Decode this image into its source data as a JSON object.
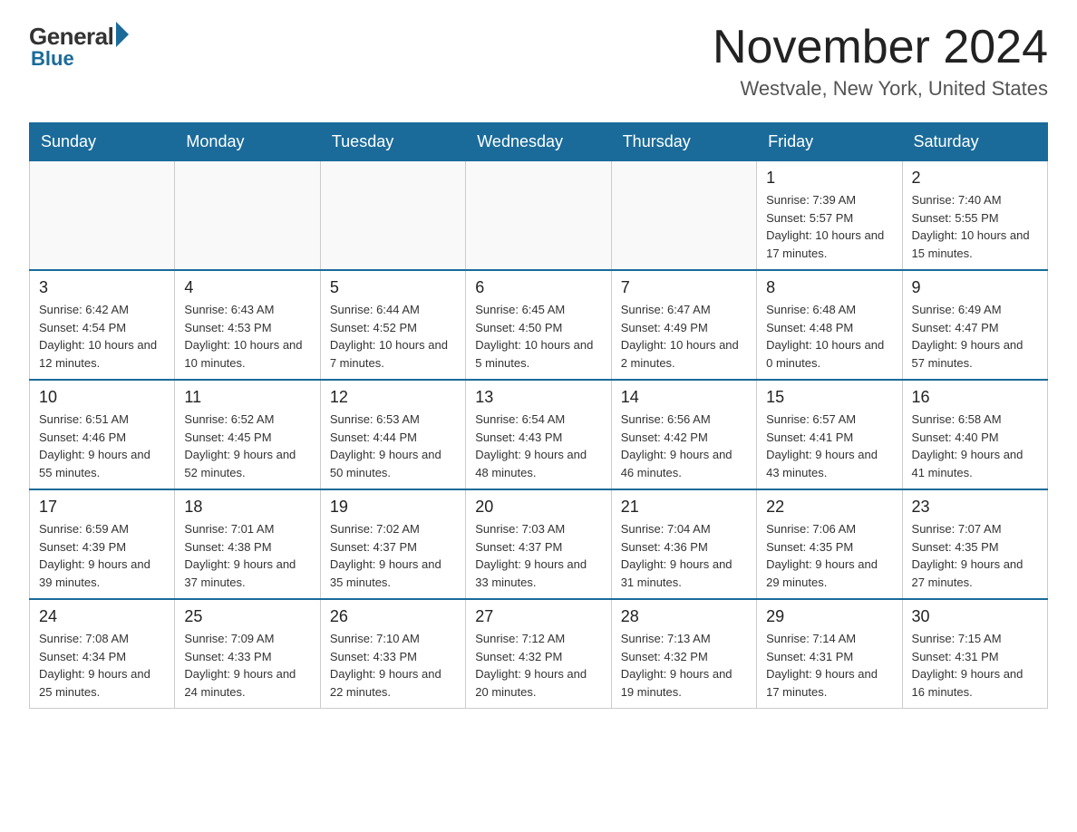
{
  "logo": {
    "general": "General",
    "blue": "Blue"
  },
  "title": "November 2024",
  "location": "Westvale, New York, United States",
  "days_of_week": [
    "Sunday",
    "Monday",
    "Tuesday",
    "Wednesday",
    "Thursday",
    "Friday",
    "Saturday"
  ],
  "weeks": [
    [
      {
        "day": "",
        "info": ""
      },
      {
        "day": "",
        "info": ""
      },
      {
        "day": "",
        "info": ""
      },
      {
        "day": "",
        "info": ""
      },
      {
        "day": "",
        "info": ""
      },
      {
        "day": "1",
        "info": "Sunrise: 7:39 AM\nSunset: 5:57 PM\nDaylight: 10 hours and 17 minutes."
      },
      {
        "day": "2",
        "info": "Sunrise: 7:40 AM\nSunset: 5:55 PM\nDaylight: 10 hours and 15 minutes."
      }
    ],
    [
      {
        "day": "3",
        "info": "Sunrise: 6:42 AM\nSunset: 4:54 PM\nDaylight: 10 hours and 12 minutes."
      },
      {
        "day": "4",
        "info": "Sunrise: 6:43 AM\nSunset: 4:53 PM\nDaylight: 10 hours and 10 minutes."
      },
      {
        "day": "5",
        "info": "Sunrise: 6:44 AM\nSunset: 4:52 PM\nDaylight: 10 hours and 7 minutes."
      },
      {
        "day": "6",
        "info": "Sunrise: 6:45 AM\nSunset: 4:50 PM\nDaylight: 10 hours and 5 minutes."
      },
      {
        "day": "7",
        "info": "Sunrise: 6:47 AM\nSunset: 4:49 PM\nDaylight: 10 hours and 2 minutes."
      },
      {
        "day": "8",
        "info": "Sunrise: 6:48 AM\nSunset: 4:48 PM\nDaylight: 10 hours and 0 minutes."
      },
      {
        "day": "9",
        "info": "Sunrise: 6:49 AM\nSunset: 4:47 PM\nDaylight: 9 hours and 57 minutes."
      }
    ],
    [
      {
        "day": "10",
        "info": "Sunrise: 6:51 AM\nSunset: 4:46 PM\nDaylight: 9 hours and 55 minutes."
      },
      {
        "day": "11",
        "info": "Sunrise: 6:52 AM\nSunset: 4:45 PM\nDaylight: 9 hours and 52 minutes."
      },
      {
        "day": "12",
        "info": "Sunrise: 6:53 AM\nSunset: 4:44 PM\nDaylight: 9 hours and 50 minutes."
      },
      {
        "day": "13",
        "info": "Sunrise: 6:54 AM\nSunset: 4:43 PM\nDaylight: 9 hours and 48 minutes."
      },
      {
        "day": "14",
        "info": "Sunrise: 6:56 AM\nSunset: 4:42 PM\nDaylight: 9 hours and 46 minutes."
      },
      {
        "day": "15",
        "info": "Sunrise: 6:57 AM\nSunset: 4:41 PM\nDaylight: 9 hours and 43 minutes."
      },
      {
        "day": "16",
        "info": "Sunrise: 6:58 AM\nSunset: 4:40 PM\nDaylight: 9 hours and 41 minutes."
      }
    ],
    [
      {
        "day": "17",
        "info": "Sunrise: 6:59 AM\nSunset: 4:39 PM\nDaylight: 9 hours and 39 minutes."
      },
      {
        "day": "18",
        "info": "Sunrise: 7:01 AM\nSunset: 4:38 PM\nDaylight: 9 hours and 37 minutes."
      },
      {
        "day": "19",
        "info": "Sunrise: 7:02 AM\nSunset: 4:37 PM\nDaylight: 9 hours and 35 minutes."
      },
      {
        "day": "20",
        "info": "Sunrise: 7:03 AM\nSunset: 4:37 PM\nDaylight: 9 hours and 33 minutes."
      },
      {
        "day": "21",
        "info": "Sunrise: 7:04 AM\nSunset: 4:36 PM\nDaylight: 9 hours and 31 minutes."
      },
      {
        "day": "22",
        "info": "Sunrise: 7:06 AM\nSunset: 4:35 PM\nDaylight: 9 hours and 29 minutes."
      },
      {
        "day": "23",
        "info": "Sunrise: 7:07 AM\nSunset: 4:35 PM\nDaylight: 9 hours and 27 minutes."
      }
    ],
    [
      {
        "day": "24",
        "info": "Sunrise: 7:08 AM\nSunset: 4:34 PM\nDaylight: 9 hours and 25 minutes."
      },
      {
        "day": "25",
        "info": "Sunrise: 7:09 AM\nSunset: 4:33 PM\nDaylight: 9 hours and 24 minutes."
      },
      {
        "day": "26",
        "info": "Sunrise: 7:10 AM\nSunset: 4:33 PM\nDaylight: 9 hours and 22 minutes."
      },
      {
        "day": "27",
        "info": "Sunrise: 7:12 AM\nSunset: 4:32 PM\nDaylight: 9 hours and 20 minutes."
      },
      {
        "day": "28",
        "info": "Sunrise: 7:13 AM\nSunset: 4:32 PM\nDaylight: 9 hours and 19 minutes."
      },
      {
        "day": "29",
        "info": "Sunrise: 7:14 AM\nSunset: 4:31 PM\nDaylight: 9 hours and 17 minutes."
      },
      {
        "day": "30",
        "info": "Sunrise: 7:15 AM\nSunset: 4:31 PM\nDaylight: 9 hours and 16 minutes."
      }
    ]
  ]
}
